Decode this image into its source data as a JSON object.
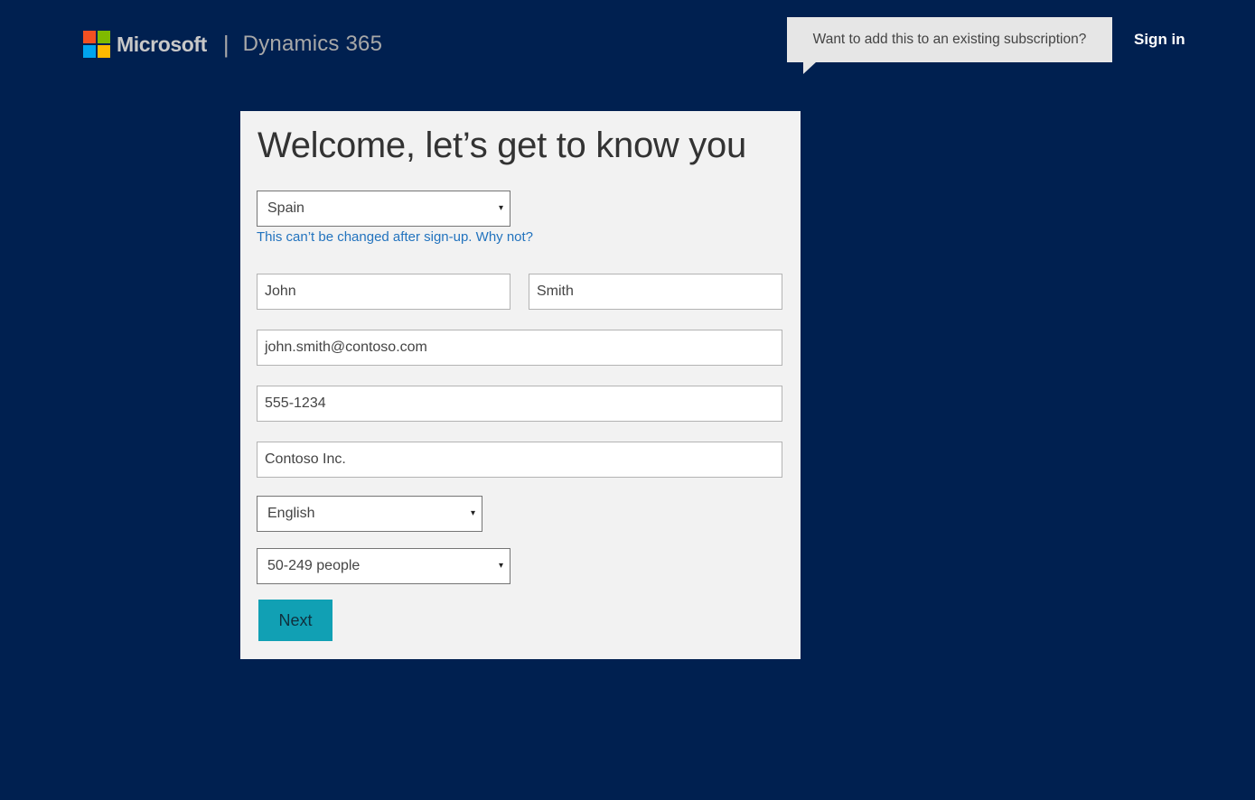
{
  "header": {
    "brand_name": "Microsoft",
    "separator": "|",
    "product_name": "Dynamics 365",
    "logo_colors": [
      "#f25022",
      "#7fba00",
      "#00a4ef",
      "#ffb900"
    ],
    "tooltip_text": "Want to add this to an existing subscription?",
    "sign_in_label": "Sign in"
  },
  "form": {
    "title": "Welcome, let’s get to know you",
    "country": {
      "selected": "Spain"
    },
    "country_hint": "This can’t be changed after sign-up.",
    "country_hint_link": "Why not?",
    "first_name": "John",
    "last_name": "Smith",
    "email": "john.smith@contoso.com",
    "phone": "555-1234",
    "company": "Contoso Inc.",
    "language": {
      "selected": "English"
    },
    "company_size": {
      "selected": "50-249 people"
    },
    "next_label": "Next"
  },
  "colors": {
    "background": "#002050",
    "card": "#f2f2f2",
    "accent_button": "#11a0b4",
    "link": "#2273be"
  },
  "icons": {
    "caret": "▾"
  }
}
